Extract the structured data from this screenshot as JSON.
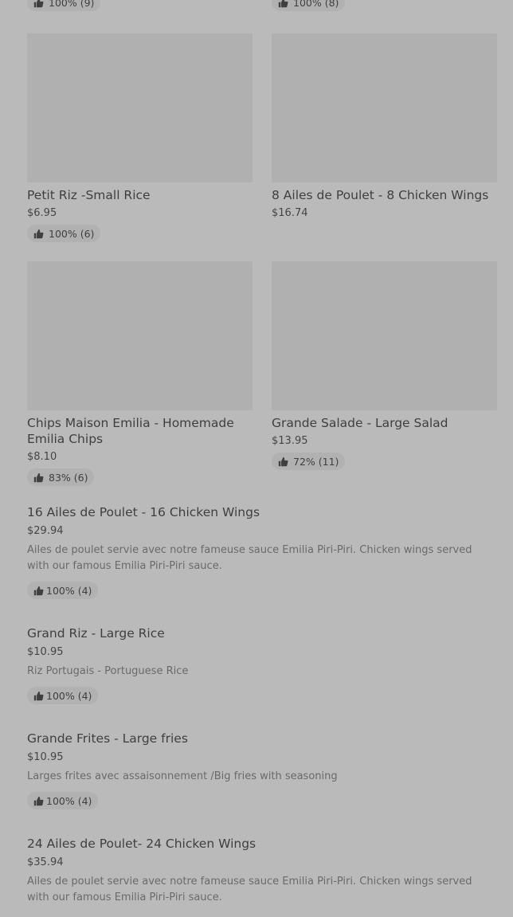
{
  "top_row": {
    "left_rating": "100% (9)",
    "right_rating": "100% (8)"
  },
  "cards": [
    {
      "title": "Petit Riz -Small Rice",
      "price": "$6.95",
      "rating": "100% (6)"
    },
    {
      "title": "8 Ailes de Poulet - 8 Chicken Wings",
      "price": "$16.74",
      "rating": ""
    },
    {
      "title": "Chips Maison Emilia - Homemade Emilia Chips",
      "price": "$8.10",
      "rating": "83% (6)"
    },
    {
      "title": "Grande Salade - Large Salad",
      "price": "$13.95",
      "rating": "72% (11)"
    }
  ],
  "list": [
    {
      "title": "16 Ailes de Poulet - 16 Chicken Wings",
      "price": "$29.94",
      "description": "Ailes de poulet servie avec notre fameuse sauce Emilia Piri-Piri. Chicken wings served with our famous Emilia Piri-Piri sauce.",
      "rating": "100% (4)"
    },
    {
      "title": "Grand Riz - Large Rice",
      "price": "$10.95",
      "description": "Riz Portugais - Portuguese Rice",
      "rating": "100% (4)"
    },
    {
      "title": "Grande Frites - Large fries",
      "price": "$10.95",
      "description": "Larges frites avec assaisonnement /Big fries with seasoning",
      "rating": "100% (4)"
    },
    {
      "title": "24 Ailes de Poulet- 24 Chicken Wings",
      "price": "$35.94",
      "description": "Ailes de poulet servie avec notre fameuse sauce Emilia Piri-Piri. Chicken wings served with our famous Emilia Piri-Piri sauce.",
      "rating": ""
    }
  ],
  "icons": {
    "rating": "thumbs-up-icon"
  },
  "colors": {
    "background": "#bababa",
    "image_placeholder": "#b0b0b0",
    "badge": "#b1b1b1",
    "text": "#3f3f3f",
    "description": "#6a6a6a"
  }
}
